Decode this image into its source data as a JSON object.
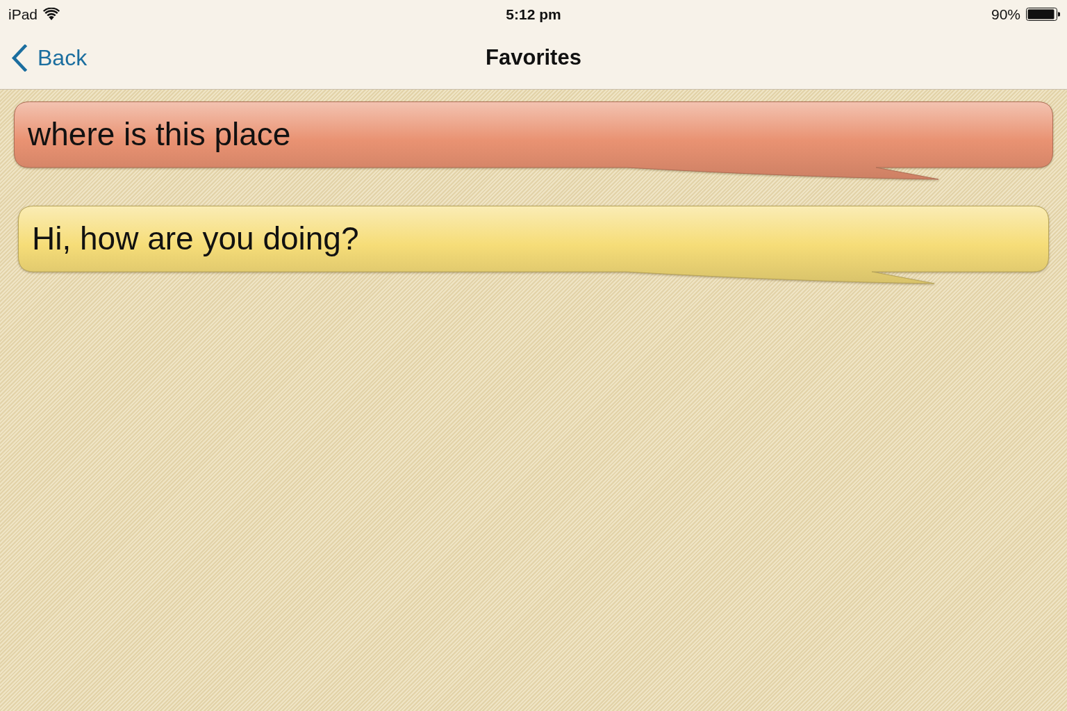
{
  "status_bar": {
    "device": "iPad",
    "time": "5:12 pm",
    "battery": "90%"
  },
  "nav_bar": {
    "back_button": "Back",
    "title": "Favorites"
  },
  "messages": [
    {
      "text": "where is this place",
      "color": "#e99272"
    },
    {
      "text": "Hi, how are you doing?",
      "color": "#f6dd78"
    }
  ]
}
